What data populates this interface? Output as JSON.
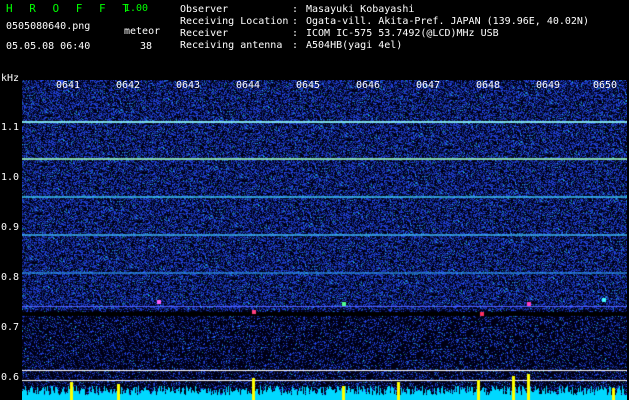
{
  "header": {
    "app_name": "H R O F F T",
    "version": "1.00",
    "filename": "0505080640.png",
    "meteor_label": "meteor",
    "meteor_count": "38",
    "datetime": "05.05.08 06:40",
    "fields": [
      {
        "label": "Observer",
        "sep": ":",
        "value": "Masayuki Kobayashi"
      },
      {
        "label": "Receiving Location",
        "sep": ":",
        "value": "Ogata-vill. Akita-Pref. JAPAN (139.96E, 40.02N)"
      },
      {
        "label": "Receiver",
        "sep": ":",
        "value": "ICOM IC-575 53.7492(@LCD)MHz USB"
      },
      {
        "label": "Receiving antenna",
        "sep": ":",
        "value": "A504HB(yagi 4el)"
      }
    ]
  },
  "axis": {
    "unit": "kHz",
    "y_ticks": [
      "1.1",
      "1.0",
      "0.9",
      "0.8",
      "0.7",
      "0.6"
    ],
    "time_ticks": [
      "0641",
      "0642",
      "0643",
      "0644",
      "0645",
      "0646",
      "0647",
      "0648",
      "0649",
      "0650"
    ]
  },
  "colors": {
    "background": "#000000",
    "noise": "#1a3aff",
    "carrier": "#00ffff",
    "header_text": "#ffffff",
    "brand": "#00ff00",
    "level_bars": "#00e5ff",
    "level_peaks": "#ffff00"
  }
}
